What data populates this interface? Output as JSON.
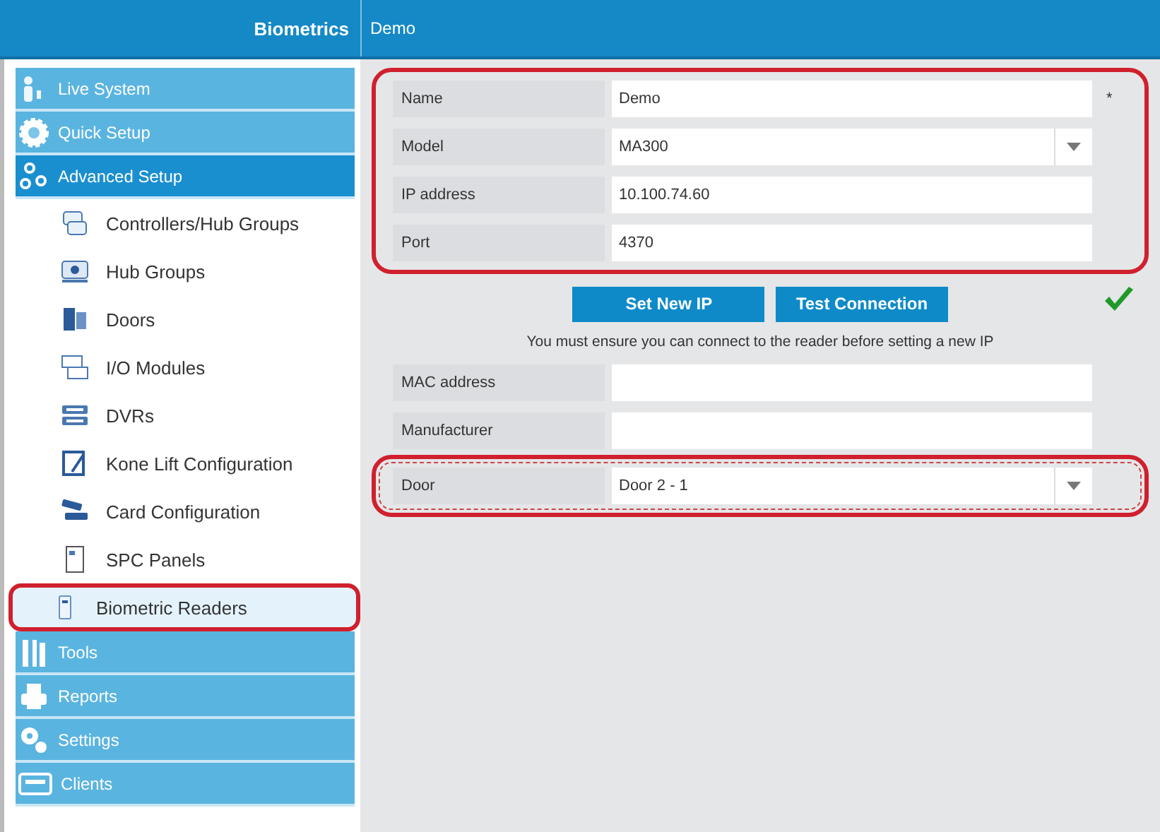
{
  "header": {
    "section": "Biometrics",
    "title": "Demo"
  },
  "sidebar": {
    "groups_before": [
      {
        "label": "Live System",
        "selected": false
      },
      {
        "label": "Quick Setup",
        "selected": false
      },
      {
        "label": "Advanced Setup",
        "selected": true
      }
    ],
    "items": [
      {
        "label": "Controllers/Hub Groups",
        "selected": false,
        "circled": false
      },
      {
        "label": "Hub Groups",
        "selected": false,
        "circled": false
      },
      {
        "label": "Doors",
        "selected": false,
        "circled": false
      },
      {
        "label": "I/O Modules",
        "selected": false,
        "circled": false
      },
      {
        "label": "DVRs",
        "selected": false,
        "circled": false
      },
      {
        "label": "Kone Lift Configuration",
        "selected": false,
        "circled": false
      },
      {
        "label": "Card Configuration",
        "selected": false,
        "circled": false
      },
      {
        "label": "SPC Panels",
        "selected": false,
        "circled": false
      },
      {
        "label": "Biometric Readers",
        "selected": true,
        "circled": true
      }
    ],
    "groups_after": [
      {
        "label": "Tools",
        "selected": false
      },
      {
        "label": "Reports",
        "selected": false
      },
      {
        "label": "Settings",
        "selected": false
      },
      {
        "label": "Clients",
        "selected": false
      }
    ]
  },
  "form": {
    "top_group": {
      "circled": true,
      "fields": [
        {
          "kind": "text",
          "label": "Name",
          "value": "Demo",
          "required_mark": "*"
        },
        {
          "kind": "dropdown",
          "label": "Model",
          "value": "MA300"
        },
        {
          "kind": "text",
          "label": "IP address",
          "value": "10.100.74.60"
        },
        {
          "kind": "text",
          "label": "Port",
          "value": "4370"
        }
      ]
    },
    "buttons": [
      "Set New IP",
      "Test Connection"
    ],
    "connection_ok": true,
    "notice": "You must ensure you can connect to the reader before setting a new IP",
    "middle_fields": [
      {
        "kind": "text",
        "label": "MAC address"
      },
      {
        "kind": "text",
        "label": "Manufacturer"
      }
    ],
    "bottom_group": {
      "circled": true,
      "fields": [
        {
          "kind": "dropdown",
          "label": "Door",
          "value": "Door 2 - 1"
        }
      ]
    }
  }
}
